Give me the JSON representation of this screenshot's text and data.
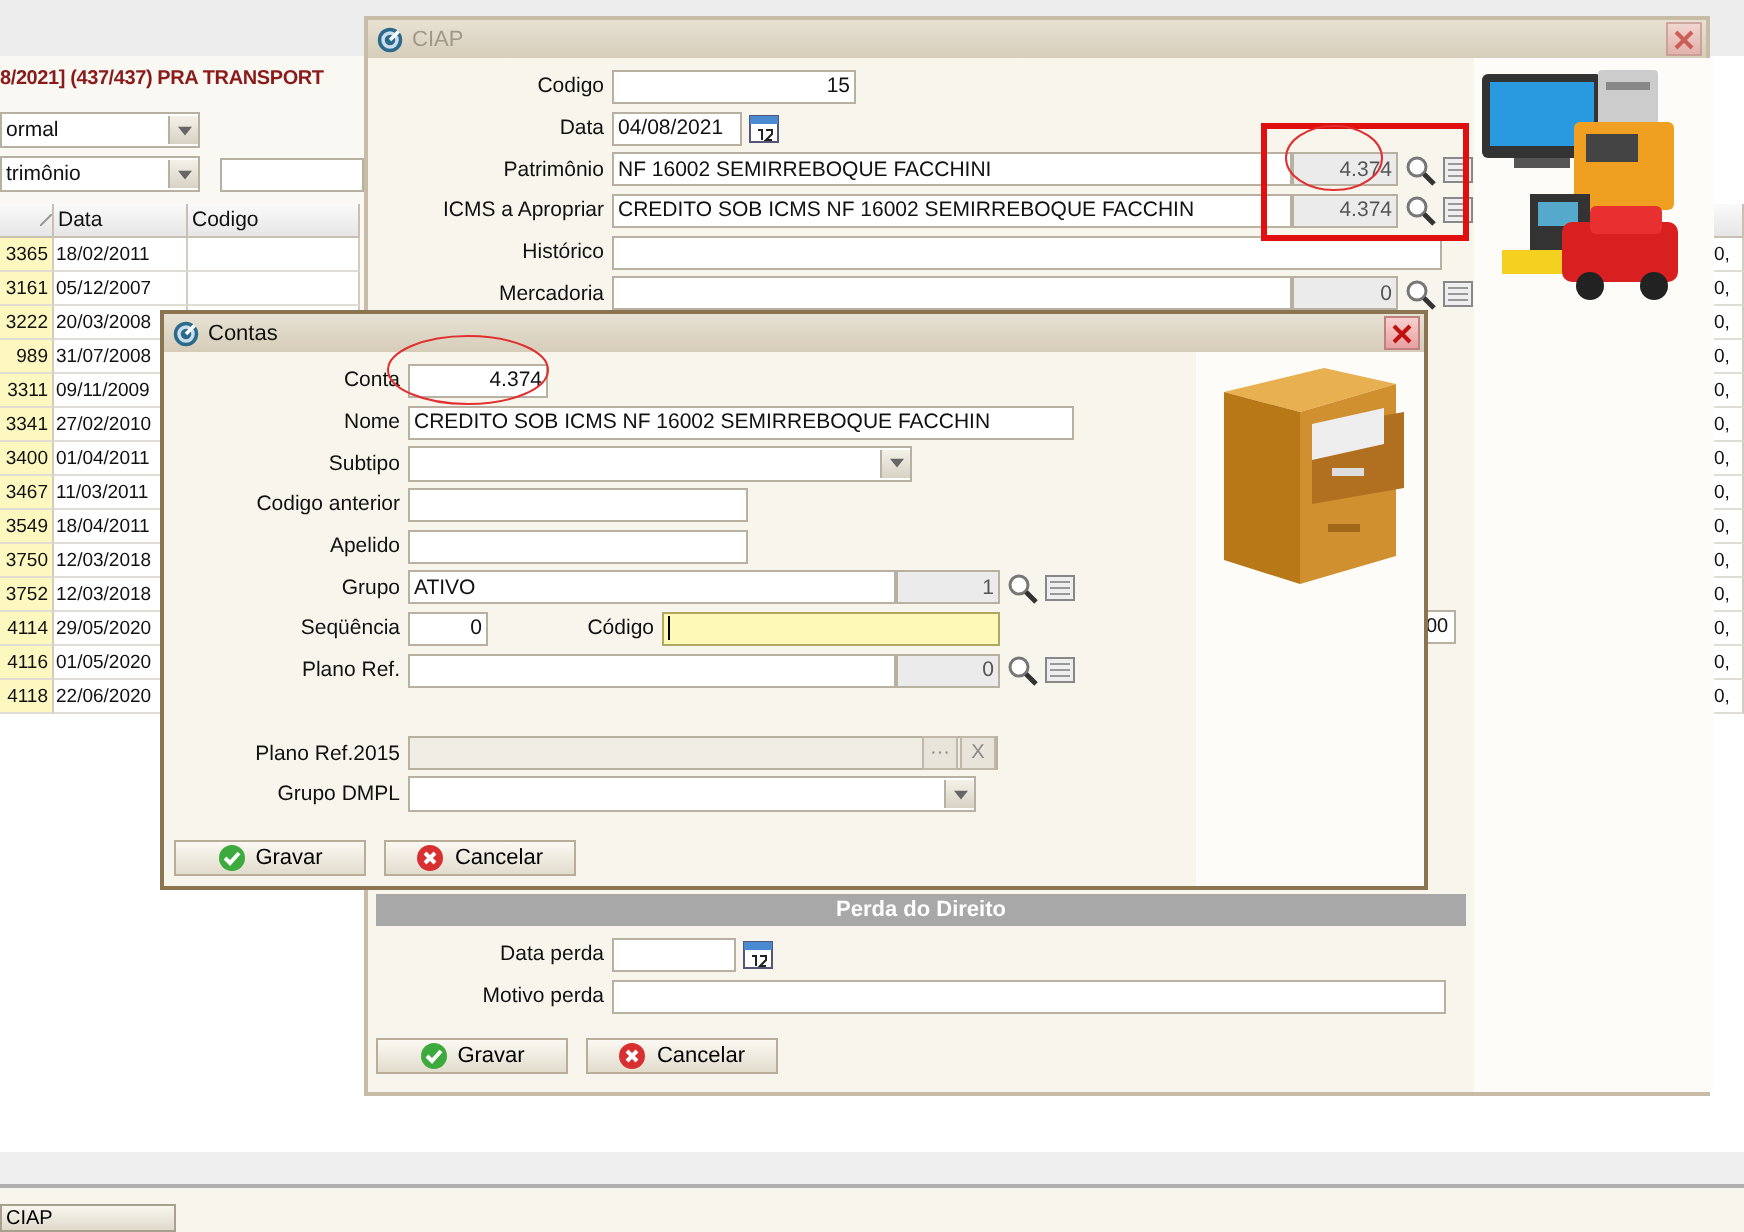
{
  "background": {
    "header": "8/2021] (437/437) PRA TRANSPORT",
    "filters": [
      {
        "kind": "combo",
        "value": "ormal"
      },
      {
        "kind": "combo-field",
        "value": "trimônio"
      }
    ],
    "grid": {
      "columns": [
        "Data",
        "Codigo"
      ],
      "rows": [
        {
          "number": "3365",
          "date": "18/02/2011",
          "value": "0,"
        },
        {
          "number": "3161",
          "date": "05/12/2007",
          "value": "0,"
        },
        {
          "number": "3222",
          "date": "20/03/2008",
          "value": "0,"
        },
        {
          "number": "989",
          "date": "31/07/2008",
          "value": "0,"
        },
        {
          "number": "3311",
          "date": "09/11/2009",
          "value": "0,"
        },
        {
          "number": "3341",
          "date": "27/02/2010",
          "value": "0,"
        },
        {
          "number": "3400",
          "date": "01/04/2011",
          "value": "0,"
        },
        {
          "number": "3467",
          "date": "11/03/2011",
          "value": "0,"
        },
        {
          "number": "3549",
          "date": "18/04/2011",
          "value": "0,"
        },
        {
          "number": "3750",
          "date": "12/03/2018",
          "value": "0,"
        },
        {
          "number": "3752",
          "date": "12/03/2018",
          "value": "0,"
        },
        {
          "number": "4114",
          "date": "29/05/2020",
          "value": "0,"
        },
        {
          "number": "4116",
          "date": "01/05/2020",
          "value": "0,"
        },
        {
          "number": "4118",
          "date": "22/06/2020",
          "value": "0,"
        }
      ]
    }
  },
  "ciap": {
    "title": "CIAP",
    "active": false,
    "fields": [
      {
        "label": "Codigo",
        "kind": "number",
        "value": "15"
      },
      {
        "label": "Data",
        "kind": "date",
        "value": "04/08/2021"
      },
      {
        "label": "Patrimônio",
        "kind": "lookup",
        "value": "NF 16002 SEMIRREBOQUE FACCHINI",
        "code": "4.374"
      },
      {
        "label": "ICMS a Apropriar",
        "kind": "lookup",
        "value": "CREDITO SOB ICMS NF 16002 SEMIRREBOQUE FACCHIN",
        "code": "4.374"
      },
      {
        "label": "Histórico",
        "kind": "text"
      },
      {
        "label": "Mercadoria",
        "kind": "lookup",
        "code": "0"
      }
    ],
    "partial_value": "00",
    "section": "Perda do Direito",
    "section_fields": [
      {
        "label": "Data perda",
        "kind": "date"
      },
      {
        "label": "Motivo perda",
        "kind": "text"
      }
    ],
    "buttons": [
      {
        "kind": "save",
        "label": "Gravar"
      },
      {
        "kind": "cancel",
        "label": "Cancelar"
      }
    ]
  },
  "contas": {
    "title": "Contas",
    "active": true,
    "fields": [
      {
        "label": "Conta",
        "kind": "number",
        "value": "4.374"
      },
      {
        "label": "Nome",
        "kind": "text",
        "value": "CREDITO SOB ICMS NF 16002 SEMIRREBOQUE FACCHIN"
      },
      {
        "label": "Subtipo",
        "kind": "combo"
      },
      {
        "label": "Codigo anterior",
        "kind": "text"
      },
      {
        "label": "Apelido",
        "kind": "text"
      },
      {
        "label": "Grupo",
        "kind": "lookup",
        "value": "ATIVO",
        "code": "1"
      },
      {
        "label": "Seqüência",
        "kind": "pair",
        "value": "0",
        "label2": "Código",
        "focused": true
      },
      {
        "label": "Plano Ref.",
        "kind": "lookup",
        "code": "0"
      },
      {
        "kind": "spacer"
      },
      {
        "label": "Plano Ref.2015",
        "kind": "picker",
        "disabled": true,
        "buttons": [
          "···",
          "X"
        ]
      },
      {
        "label": "Grupo DMPL",
        "kind": "combo"
      }
    ],
    "buttons": [
      {
        "kind": "save",
        "label": "Gravar"
      },
      {
        "kind": "cancel",
        "label": "Cancelar"
      }
    ]
  },
  "taskbar": {
    "items": [
      {
        "label": "CIAP"
      }
    ]
  }
}
